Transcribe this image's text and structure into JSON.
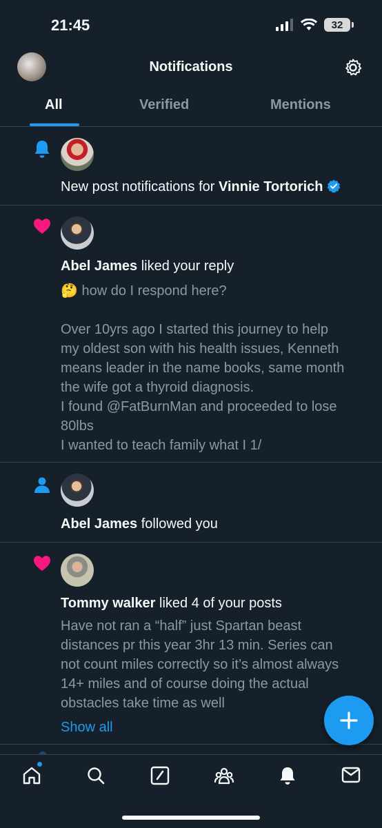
{
  "status": {
    "time": "21:45",
    "battery": "32"
  },
  "header": {
    "title": "Notifications"
  },
  "tabs": [
    {
      "label": "All"
    },
    {
      "label": "Verified"
    },
    {
      "label": "Mentions"
    }
  ],
  "notifications": [
    {
      "type": "bell",
      "prefix": "New post notifications for ",
      "name": "Vinnie Tortorich"
    },
    {
      "type": "like",
      "name": "Abel James",
      "action": " liked your reply",
      "emoji": "🤔",
      "text_lines": [
        "how do I respond here?",
        "",
        "Over 10yrs ago I started this journey to help",
        "my oldest son with his health issues, Kenneth",
        "means leader in the name books, same month",
        "the wife got a thyroid diagnosis.",
        "I found @FatBurnMan and proceeded to lose",
        "80lbs",
        "I wanted to teach family what I 1/"
      ]
    },
    {
      "type": "follow",
      "name": "Abel James",
      "action": " followed you"
    },
    {
      "type": "like",
      "name": "Tommy walker",
      "action": " liked 4 of your posts",
      "text_lines": [
        "Have not ran a “half” just Spartan beast",
        "distances pr this year 3hr 13 min. Series can",
        "not count miles correctly so it’s almost always",
        "14+ miles and of course doing the actual",
        "obstacles take time as well"
      ],
      "show_all": "Show all"
    }
  ],
  "colors": {
    "accent": "#1d9bf0",
    "like": "#f91880",
    "background": "#15202b"
  },
  "nav": [
    "home-icon",
    "search-icon",
    "compose-icon",
    "communities-icon",
    "notifications-icon",
    "messages-icon"
  ]
}
